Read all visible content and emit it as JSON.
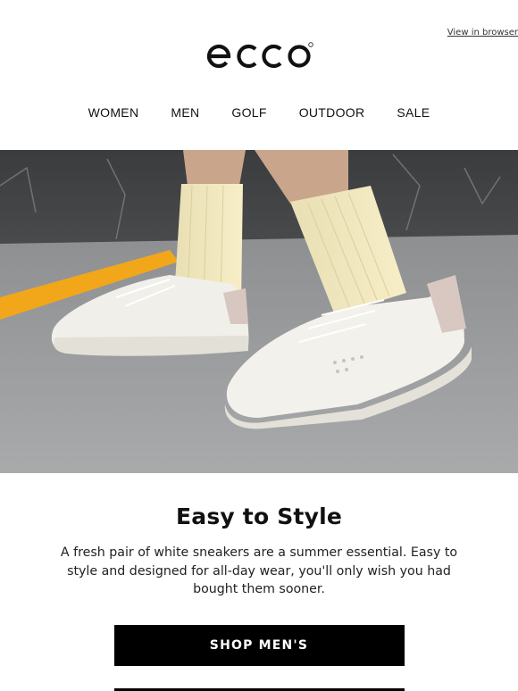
{
  "header": {
    "view_in_browser": "View in browser",
    "logo_text": "ecco"
  },
  "nav": {
    "items": [
      "WOMEN",
      "MEN",
      "GOLF",
      "OUTDOOR",
      "SALE"
    ]
  },
  "hero": {
    "image_description_icon": "sneakers-photo"
  },
  "content": {
    "title": "Easy to Style",
    "body": "A fresh pair of white sneakers are a summer essential. Easy to style and designed for all-day wear, you'll only wish you had bought them sooner.",
    "cta_label": "SHOP MEN'S"
  },
  "colors": {
    "background": "#ffffff",
    "cta_background": "#000000",
    "cta_text": "#ffffff",
    "accent_stripe": "#f2a71a"
  }
}
